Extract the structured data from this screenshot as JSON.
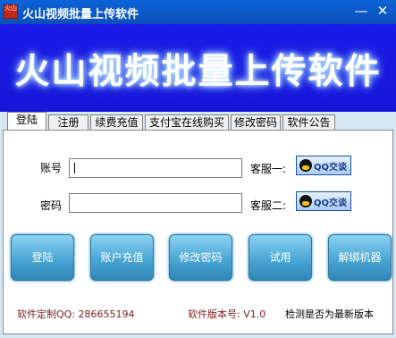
{
  "window": {
    "title": "火山视频批量上传软件",
    "icon_text": "火山",
    "min_symbol": "—",
    "close_symbol": "✕"
  },
  "banner": {
    "text": "火山视频批量上传软件"
  },
  "tabs": [
    {
      "label": "登陆",
      "active": true
    },
    {
      "label": "注册",
      "active": false
    },
    {
      "label": "续费充值",
      "active": false
    },
    {
      "label": "支付宝在线购买",
      "active": false
    },
    {
      "label": "修改密码",
      "active": false
    },
    {
      "label": "软件公告",
      "active": false
    }
  ],
  "form": {
    "account_label": "账号",
    "account_value": "",
    "password_label": "密码",
    "password_value": "",
    "service1_label": "客服一:",
    "service2_label": "客服二:",
    "qq_text": "QQ交谈"
  },
  "buttons": {
    "login": "登陆",
    "recharge": "账户充值",
    "change_pwd": "修改密码",
    "trial": "试用",
    "unbind": "解绑机器"
  },
  "footer": {
    "custom_qq": "软件定制QQ: 286655194",
    "version": "软件版本号: V1.0",
    "check_latest": "检测是否为最新版本"
  }
}
